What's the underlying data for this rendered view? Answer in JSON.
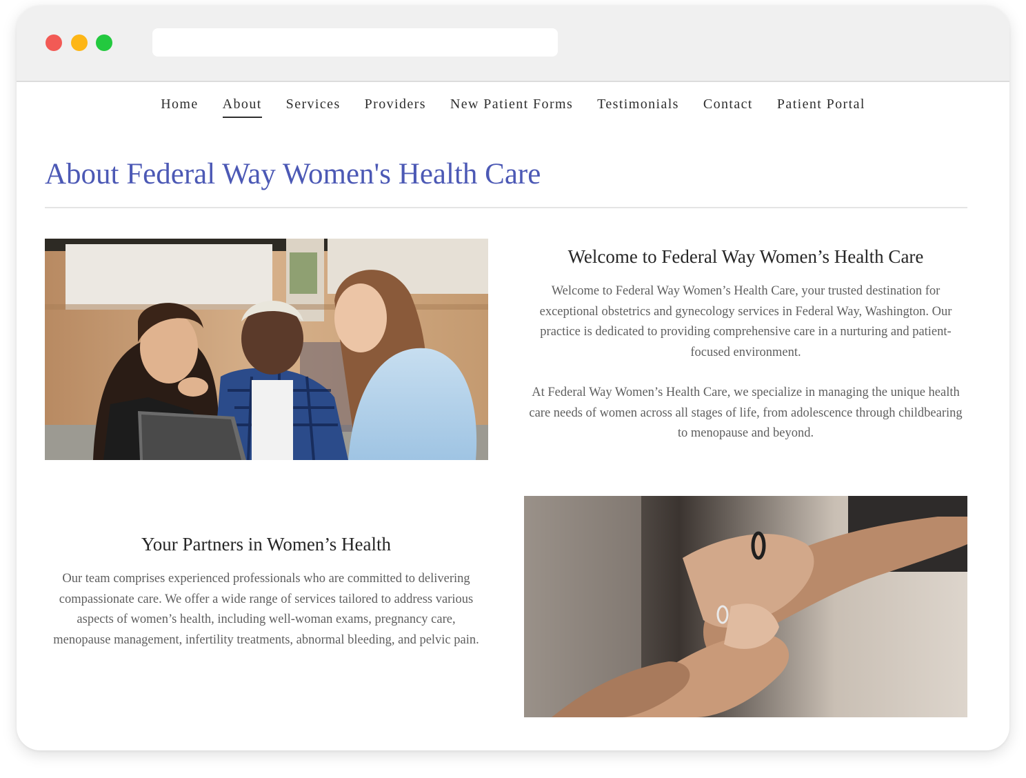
{
  "nav": {
    "items": [
      {
        "label": "Home"
      },
      {
        "label": "About"
      },
      {
        "label": "Services"
      },
      {
        "label": "Providers"
      },
      {
        "label": "New Patient Forms"
      },
      {
        "label": "Testimonials"
      },
      {
        "label": "Contact"
      },
      {
        "label": "Patient Portal"
      }
    ],
    "active": "About"
  },
  "page": {
    "title": "About Federal Way Women's Health Care"
  },
  "welcome": {
    "heading": "Welcome to Federal Way Women’s Health Care",
    "paragraph1": "Welcome to Federal Way Women’s Health Care, your trusted destination for exceptional obstetrics and gynecology services in Federal Way, Washington. Our practice is dedicated to providing comprehensive care in a nurturing and patient-focused environment.",
    "paragraph2": "At Federal Way Women’s Health Care, we specialize in managing the unique health care needs of women across all stages of life, from adolescence through childbearing to menopause and beyond."
  },
  "partners": {
    "heading": "Your Partners in Women’s Health",
    "paragraph": "Our team comprises experienced professionals who are committed to delivering compassionate care. We offer a wide range of services tailored to address various aspects of women’s health, including well-woman exams, pregnancy care, menopause management, infertility treatments, abnormal bleeding, and pelvic pain."
  },
  "colors": {
    "title_accent": "#4c59b5",
    "dot_red": "#f25a55",
    "dot_yellow": "#fdb616",
    "dot_green": "#23c93f"
  }
}
